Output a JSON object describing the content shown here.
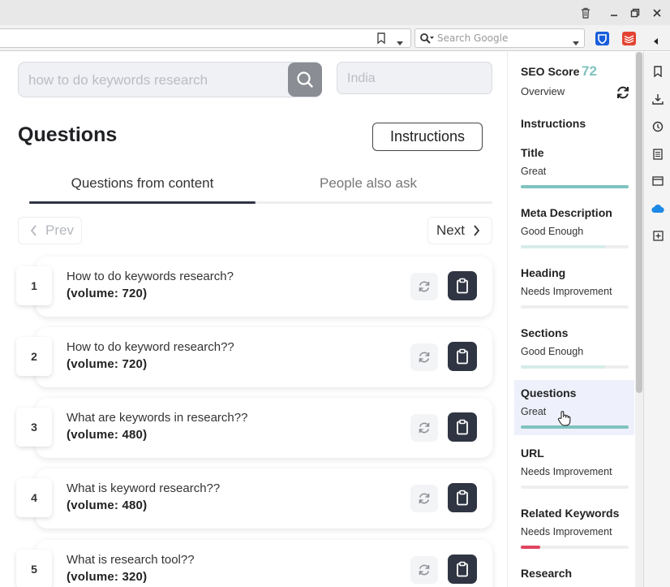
{
  "browser": {
    "search_placeholder": "Search Google"
  },
  "keyword": {
    "placeholder": "how to do keywords research",
    "country": "India"
  },
  "header": {
    "title": "Questions",
    "instructions_label": "Instructions"
  },
  "tabs": [
    {
      "label": "Questions from content",
      "active": true
    },
    {
      "label": "People also ask",
      "active": false
    }
  ],
  "pager": {
    "prev": "Prev",
    "next": "Next"
  },
  "questions": [
    {
      "num": "1",
      "text": "How to do keywords research?",
      "volume": "(volume: 720)"
    },
    {
      "num": "2",
      "text": "How to do keyword research??",
      "volume": "(volume: 720)"
    },
    {
      "num": "3",
      "text": "What are keywords in research??",
      "volume": "(volume: 480)"
    },
    {
      "num": "4",
      "text": "What is keyword research??",
      "volume": "(volume: 480)"
    },
    {
      "num": "5",
      "text": "What is research tool??",
      "volume": "(volume: 320)"
    }
  ],
  "seo": {
    "score_label": "SEO Score",
    "score": "72",
    "overview": "Overview",
    "instructions": "Instructions",
    "items": [
      {
        "name": "Title",
        "status": "Great",
        "level": 1.0,
        "color": "#7fc3bf",
        "active": false
      },
      {
        "name": "Meta Description",
        "status": "Good Enough",
        "level": 0.78,
        "color": "#d6ece9",
        "active": false
      },
      {
        "name": "Heading",
        "status": "Needs Improvement",
        "level": 0.0,
        "color": "#eeeeee",
        "active": false
      },
      {
        "name": "Sections",
        "status": "Good Enough",
        "level": 0.78,
        "color": "#d6ece9",
        "active": false
      },
      {
        "name": "Questions",
        "status": "Great",
        "level": 1.0,
        "color": "#7fc3bf",
        "active": true
      },
      {
        "name": "URL",
        "status": "Needs Improvement",
        "level": 0.0,
        "color": "#eeeeee",
        "active": false
      },
      {
        "name": "Related Keywords",
        "status": "Needs Improvement",
        "level": 0.18,
        "color": "#e0455f",
        "active": false
      },
      {
        "name": "Research",
        "status": "",
        "level": 0.0,
        "color": "#eeeeee",
        "active": false
      }
    ]
  }
}
